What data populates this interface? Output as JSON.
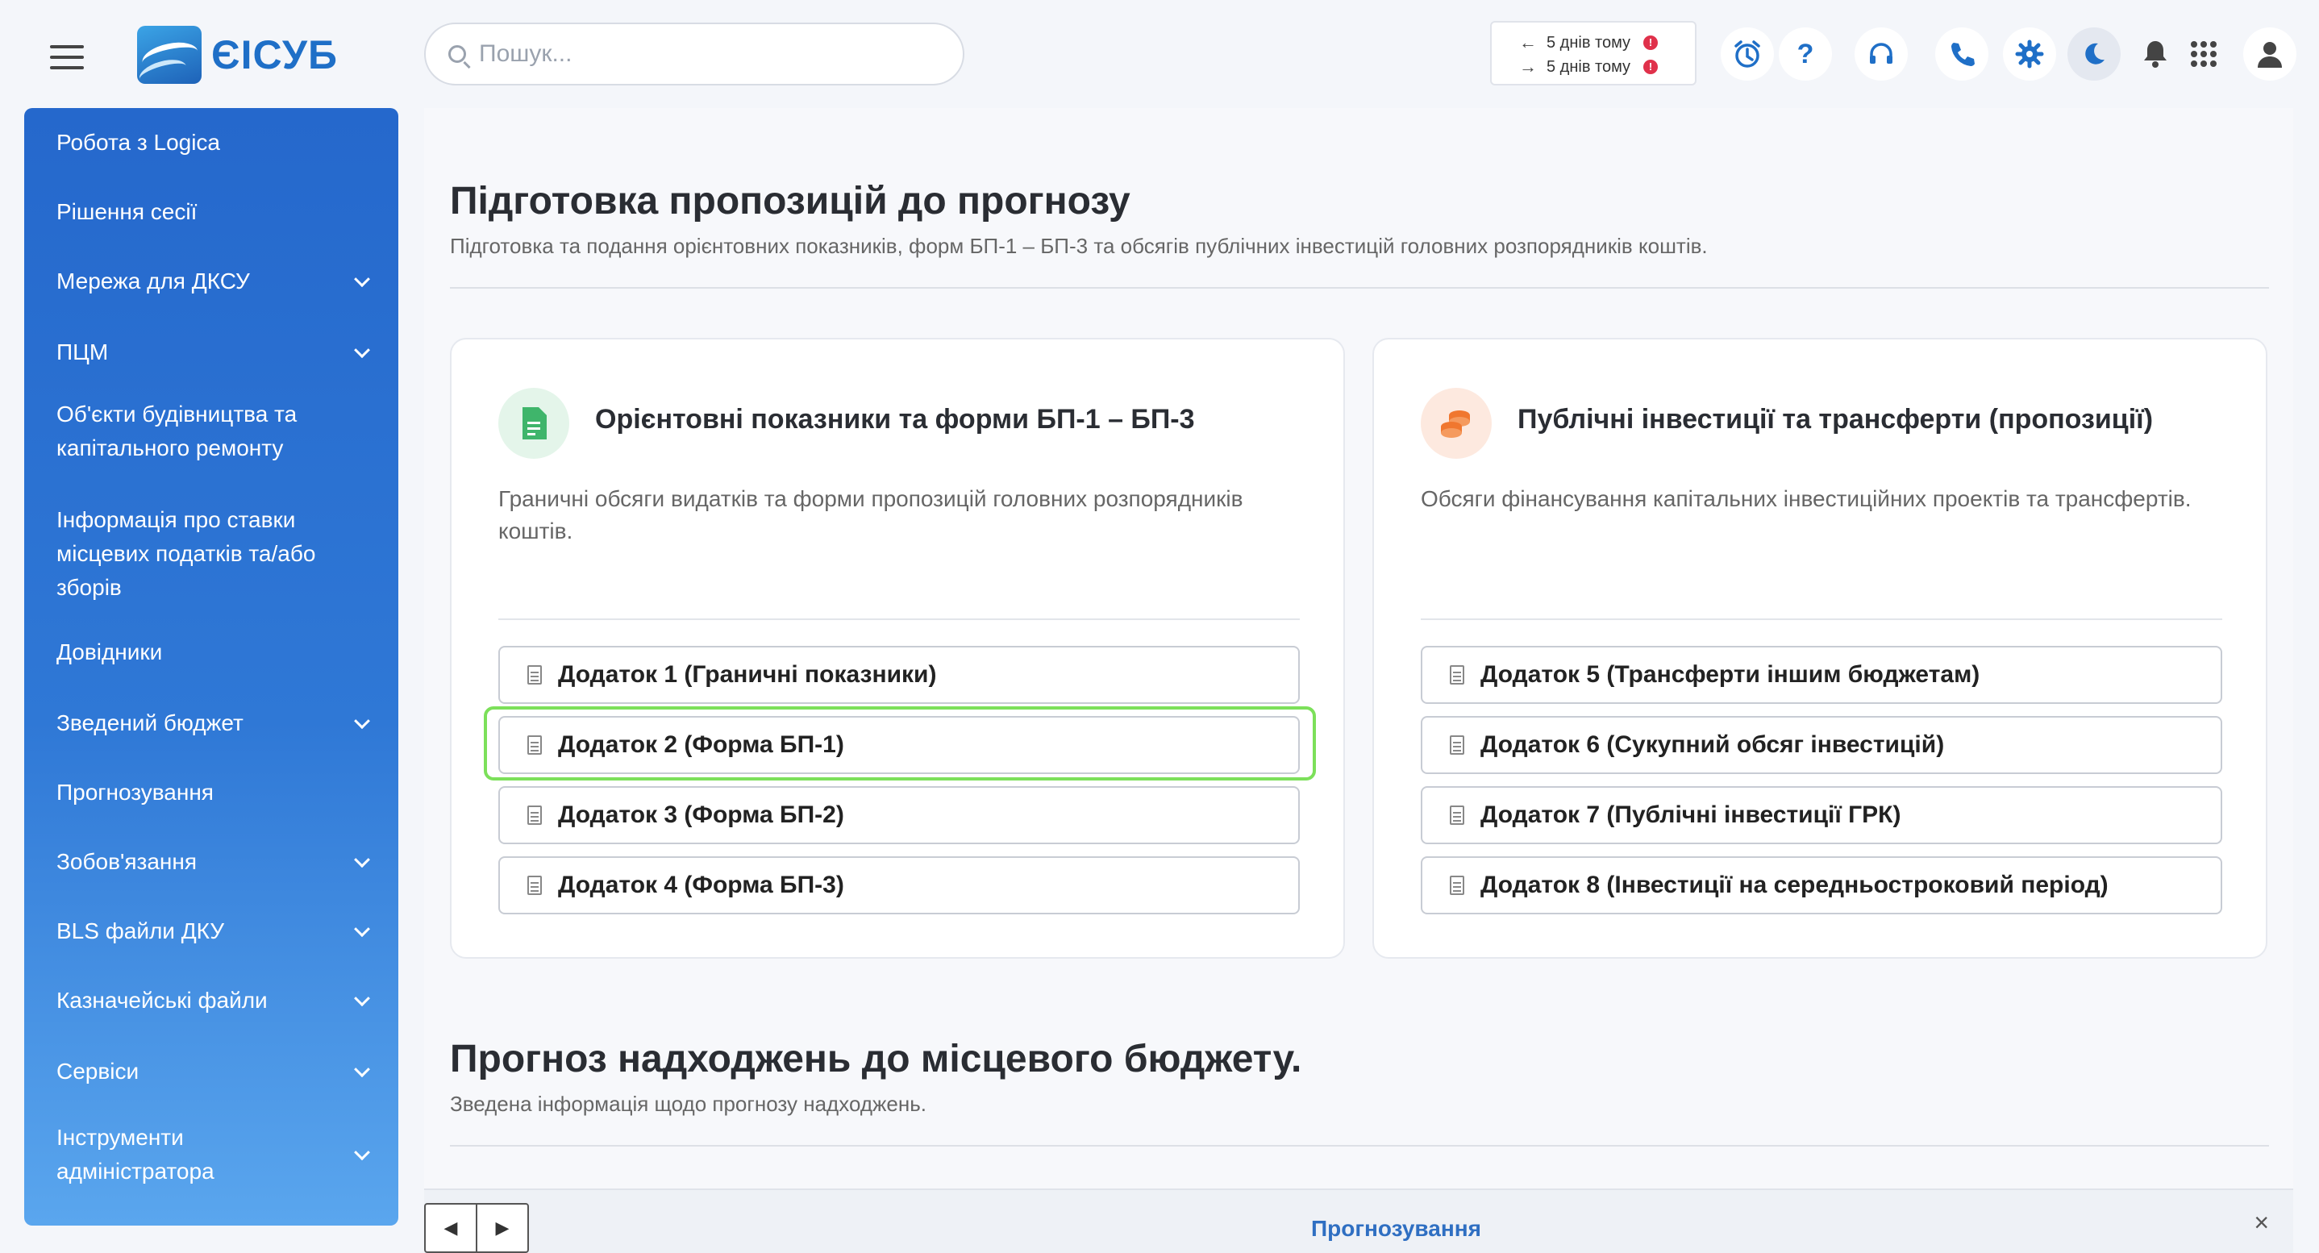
{
  "app": {
    "name": "ЄІСУБ"
  },
  "search": {
    "placeholder": "Пошук..."
  },
  "sync": {
    "outgoing": "5 днів тому",
    "incoming": "5 днів тому",
    "badge": "!"
  },
  "sidebar": {
    "items": [
      {
        "label": "Робота з Logica",
        "expandable": false
      },
      {
        "label": "Рішення сесії",
        "expandable": false
      },
      {
        "label": "Мережа для ДКСУ",
        "expandable": true
      },
      {
        "label": "ПЦМ",
        "expandable": true
      },
      {
        "label": "Об'єкти будівництва та капітального ремонту",
        "expandable": false
      },
      {
        "label": "Інформація про ставки місцевих податків та/або зборів",
        "expandable": false
      },
      {
        "label": "Довідники",
        "expandable": false
      },
      {
        "label": "Зведений бюджет",
        "expandable": true
      },
      {
        "label": "Прогнозування",
        "expandable": false
      },
      {
        "label": "Зобов'язання",
        "expandable": true
      },
      {
        "label": "BLS файли ДКУ",
        "expandable": true
      },
      {
        "label": "Казначейські файли",
        "expandable": true
      },
      {
        "label": "Сервіси",
        "expandable": true
      },
      {
        "label": "Інструменти адміністратора",
        "expandable": true
      }
    ]
  },
  "section1": {
    "title": "Підготовка пропозицій до прогнозу",
    "subtitle": "Підготовка та подання орієнтовних показників, форм БП-1 – БП-3 та обсягів публічних інвестицій головних розпорядників коштів."
  },
  "card_left": {
    "title": "Орієнтовні показники та форми БП-1 – БП-3",
    "description": "Граничні обсяги видатків та форми пропозицій головних розпорядників коштів.",
    "buttons": [
      "Додаток 1 (Граничні показники)",
      "Додаток 2 (Форма БП-1)",
      "Додаток 3 (Форма БП-2)",
      "Додаток 4 (Форма БП-3)"
    ]
  },
  "card_right": {
    "title": "Публічні інвестиції та трансферти (пропозиції)",
    "description": "Обсяги фінансування капітальних інвестиційних проектів та трансфертів.",
    "buttons": [
      "Додаток 5 (Трансферти іншим бюджетам)",
      "Додаток 6 (Сукупний обсяг інвестицій)",
      "Додаток 7 (Публічні інвестиції ГРК)",
      "Додаток 8 (Інвестиції на середньостроковий період)"
    ]
  },
  "section2": {
    "title": "Прогноз надходжень до місцевого бюджету.",
    "subtitle": "Зведена інформація щодо прогнозу надходжень."
  },
  "bottom": {
    "tab_label": "Прогнозування",
    "close": "×",
    "prev": "◀",
    "next": "▶"
  },
  "colors": {
    "accent": "#1f6fc7",
    "sidebar_top": "#2568cc",
    "sidebar_bottom": "#5aa6ee",
    "highlight": "#7ce05a"
  },
  "icons": [
    "hamburger-icon",
    "search-icon",
    "alarm-icon",
    "help-icon",
    "headset-icon",
    "phone-icon",
    "gear-icon",
    "moon-icon",
    "bell-icon",
    "apps-grid-icon",
    "user-icon"
  ]
}
